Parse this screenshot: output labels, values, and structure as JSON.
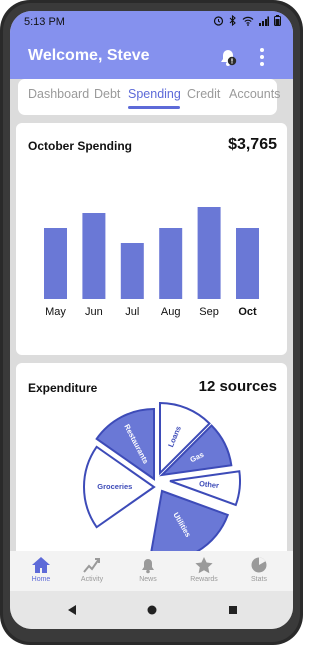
{
  "status": {
    "time": "5:13 PM"
  },
  "header": {
    "title": "Welcome, Steve"
  },
  "tabs": [
    {
      "label": "Dashboard",
      "active": false
    },
    {
      "label": "Debt",
      "active": false
    },
    {
      "label": "Spending",
      "active": true
    },
    {
      "label": "Credit",
      "active": false
    },
    {
      "label": "Accounts",
      "active": false
    }
  ],
  "spending": {
    "title": "October Spending",
    "total": "$3,765",
    "chart_data": {
      "type": "bar",
      "categories": [
        "May",
        "Jun",
        "Jul",
        "Aug",
        "Sep",
        "Oct"
      ],
      "values": [
        71,
        86,
        56,
        71,
        92,
        71
      ],
      "highlight": "Oct",
      "color": "#6a78d6"
    }
  },
  "expenditure": {
    "title": "Expenditure",
    "count": "12 sources",
    "chart_data": {
      "type": "pie",
      "labels": [
        "Utilities",
        "Groceries",
        "Restaurants",
        "Loans",
        "Gas",
        "Other"
      ],
      "color": "#6a78d6"
    }
  },
  "bottom_nav": [
    {
      "label": "Home",
      "icon": "home-icon",
      "active": true
    },
    {
      "label": "Activity",
      "icon": "activity-icon",
      "active": false
    },
    {
      "label": "News",
      "icon": "bell-icon",
      "active": false
    },
    {
      "label": "Rewards",
      "icon": "star-icon",
      "active": false
    },
    {
      "label": "Stats",
      "icon": "pie-icon",
      "active": false
    }
  ],
  "colors": {
    "accent": "#8591ee",
    "primary": "#5d6ad8",
    "bar": "#6a78d6"
  }
}
